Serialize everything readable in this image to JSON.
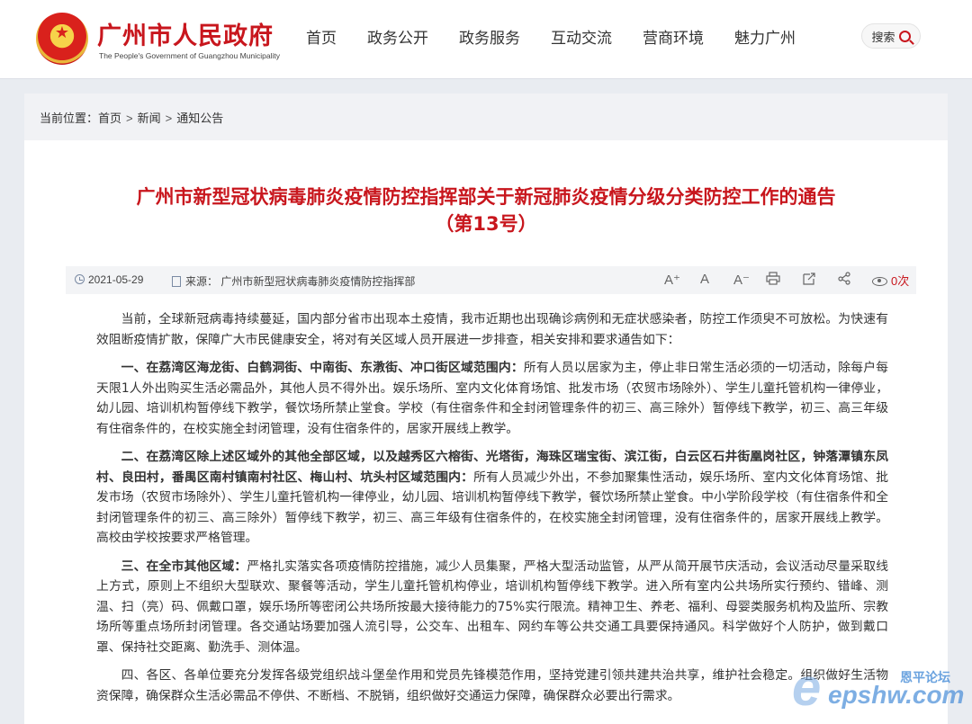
{
  "header": {
    "site_title": "广州市人民政府",
    "site_subtitle": "The People's Government of Guangzhou Municipality",
    "nav": [
      "首页",
      "政务公开",
      "政务服务",
      "互动交流",
      "营商环境",
      "魅力广州"
    ],
    "search_label": "搜索"
  },
  "breadcrumb": {
    "prefix": "当前位置：",
    "items": [
      "首页",
      "新闻",
      "通知公告"
    ],
    "separator": ">"
  },
  "article": {
    "title_line1": "广州市新型冠状病毒肺炎疫情防控指挥部关于新冠肺炎疫情分级分类防控工作的通告",
    "title_line2": "（第13号）",
    "date": "2021-05-29",
    "source": "来源： 广州市新型冠状病毒肺炎疫情防控指挥部",
    "views": "0次",
    "tools": [
      "A⁺",
      "A",
      "A⁻",
      "print",
      "share-link",
      "share"
    ],
    "paragraphs": [
      {
        "lead": "",
        "text": "当前，全球新冠病毒持续蔓延，国内部分省市出现本土疫情，我市近期也出现确诊病例和无症状感染者，防控工作须臾不可放松。为快速有效阻断疫情扩散，保障广大市民健康安全，将对有关区域人员开展进一步排查，相关安排和要求通告如下："
      },
      {
        "lead": "一、在荔湾区海龙街、白鹤洞街、中南街、东漖街、冲口街区域范围内：",
        "text": "所有人员以居家为主，停止非日常生活必须的一切活动，除每户每天限1人外出购买生活必需品外，其他人员不得外出。娱乐场所、室内文化体育场馆、批发市场（农贸市场除外）、学生儿童托管机构一律停业，幼儿园、培训机构暂停线下教学，餐饮场所禁止堂食。学校（有住宿条件和全封闭管理条件的初三、高三除外）暂停线下教学，初三、高三年级有住宿条件的，在校实施全封闭管理，没有住宿条件的，居家开展线上教学。"
      },
      {
        "lead": "二、在荔湾区除上述区域外的其他全部区域，以及越秀区六榕街、光塔街，海珠区瑞宝街、滨江街，白云区石井街凰岗社区，钟落潭镇东凤村、良田村，番禺区南村镇南村社区、梅山村、坑头村区域范围内：",
        "text": "所有人员减少外出，不参加聚集性活动，娱乐场所、室内文化体育场馆、批发市场（农贸市场除外）、学生儿童托管机构一律停业，幼儿园、培训机构暂停线下教学，餐饮场所禁止堂食。中小学阶段学校（有住宿条件和全封闭管理条件的初三、高三除外）暂停线下教学，初三、高三年级有住宿条件的，在校实施全封闭管理，没有住宿条件的，居家开展线上教学。高校由学校按要求严格管理。"
      },
      {
        "lead": "三、在全市其他区域：",
        "text": "严格扎实落实各项疫情防控措施，减少人员集聚，严格大型活动监管，从严从简开展节庆活动，会议活动尽量采取线上方式，原则上不组织大型联欢、聚餐等活动，学生儿童托管机构停业，培训机构暂停线下教学。进入所有室内公共场所实行预约、错峰、测温、扫（亮）码、佩戴口罩，娱乐场所等密闭公共场所按最大接待能力的75%实行限流。精神卫生、养老、福利、母婴类服务机构及监所、宗教场所等重点场所封闭管理。各交通站场要加强人流引导，公交车、出租车、网约车等公共交通工具要保持通风。科学做好个人防护，做到戴口罩、保持社交距离、勤洗手、测体温。"
      },
      {
        "lead": "",
        "text": "四、各区、各单位要充分发挥各级党组织战斗堡垒作用和党员先锋模范作用，坚持党建引领共建共治共享，维护社会稳定。组织做好生活物资保障，确保群众生活必需品不停供、不断档、不脱销，组织做好交通运力保障，确保群众必要出行需求。"
      }
    ]
  },
  "watermark": {
    "text": "epshw.com",
    "cn": "恩平论坛"
  },
  "colors": {
    "brand_red": "#c8161d",
    "page_bg": "#e9ecf1",
    "meta_bg": "#f3f4f6"
  }
}
